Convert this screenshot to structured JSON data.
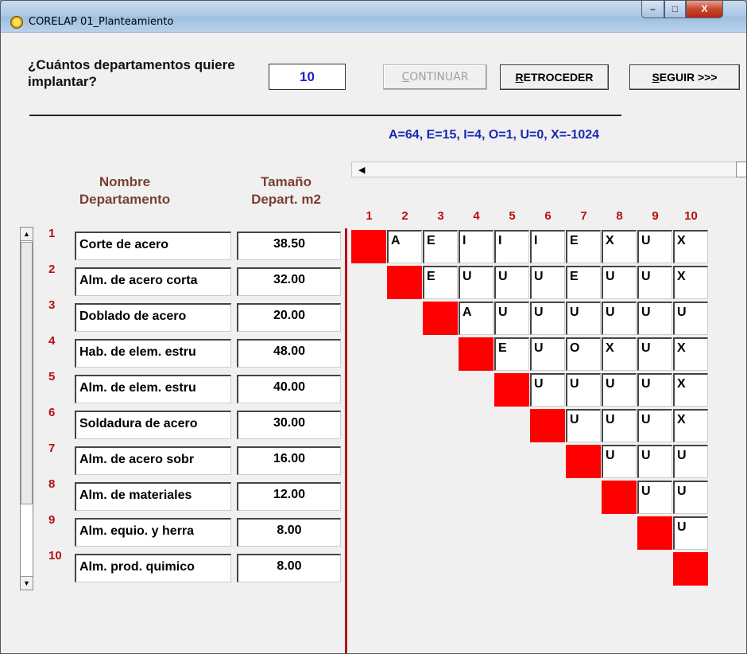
{
  "window": {
    "title": "CORELAP 01_Planteamiento"
  },
  "titlebar_buttons": {
    "minimize": "–",
    "maximize": "□",
    "close": "X"
  },
  "form": {
    "question": "¿Cuántos departamentos quiere implantar?",
    "count_value": "10",
    "buttons": {
      "continuar": "CONTINUAR",
      "retroceder": "RETROCEDER",
      "seguir": "SEGUIR >>>"
    },
    "weights": "A=64, E=15, I=4, O=1, U=0, X=-1024"
  },
  "table": {
    "name_header": "Nombre\nDepartamento",
    "size_header": "Tamaño\nDepart.  m2",
    "rows": [
      {
        "idx": "1",
        "name": "Corte de acero",
        "size": "38.50"
      },
      {
        "idx": "2",
        "name": "Alm. de acero corta",
        "size": "32.00"
      },
      {
        "idx": "3",
        "name": "Doblado de acero",
        "size": "20.00"
      },
      {
        "idx": "4",
        "name": "Hab. de elem. estru",
        "size": "48.00"
      },
      {
        "idx": "5",
        "name": "Alm. de elem. estru",
        "size": "40.00"
      },
      {
        "idx": "6",
        "name": "Soldadura de acero",
        "size": "30.00"
      },
      {
        "idx": "7",
        "name": "Alm. de acero sobr",
        "size": "16.00"
      },
      {
        "idx": "8",
        "name": "Alm. de materiales",
        "size": "12.00"
      },
      {
        "idx": "9",
        "name": "Alm. equio. y herra",
        "size": "8.00"
      },
      {
        "idx": "10",
        "name": "Alm. prod. quimico",
        "size": "8.00"
      }
    ]
  },
  "matrix": {
    "columns": [
      "1",
      "2",
      "3",
      "4",
      "5",
      "6",
      "7",
      "8",
      "9",
      "10"
    ],
    "diagonal_color": "#ff0000",
    "rows": [
      [
        "A",
        "E",
        "I",
        "I",
        "I",
        "E",
        "X",
        "U",
        "X"
      ],
      [
        "E",
        "U",
        "U",
        "U",
        "E",
        "U",
        "U",
        "X"
      ],
      [
        "A",
        "U",
        "U",
        "U",
        "U",
        "U",
        "U"
      ],
      [
        "E",
        "U",
        "O",
        "X",
        "U",
        "X"
      ],
      [
        "U",
        "U",
        "U",
        "U",
        "X"
      ],
      [
        "U",
        "U",
        "U",
        "X"
      ],
      [
        "U",
        "U",
        "U"
      ],
      [
        "U",
        "U"
      ],
      [
        "U"
      ],
      []
    ]
  }
}
